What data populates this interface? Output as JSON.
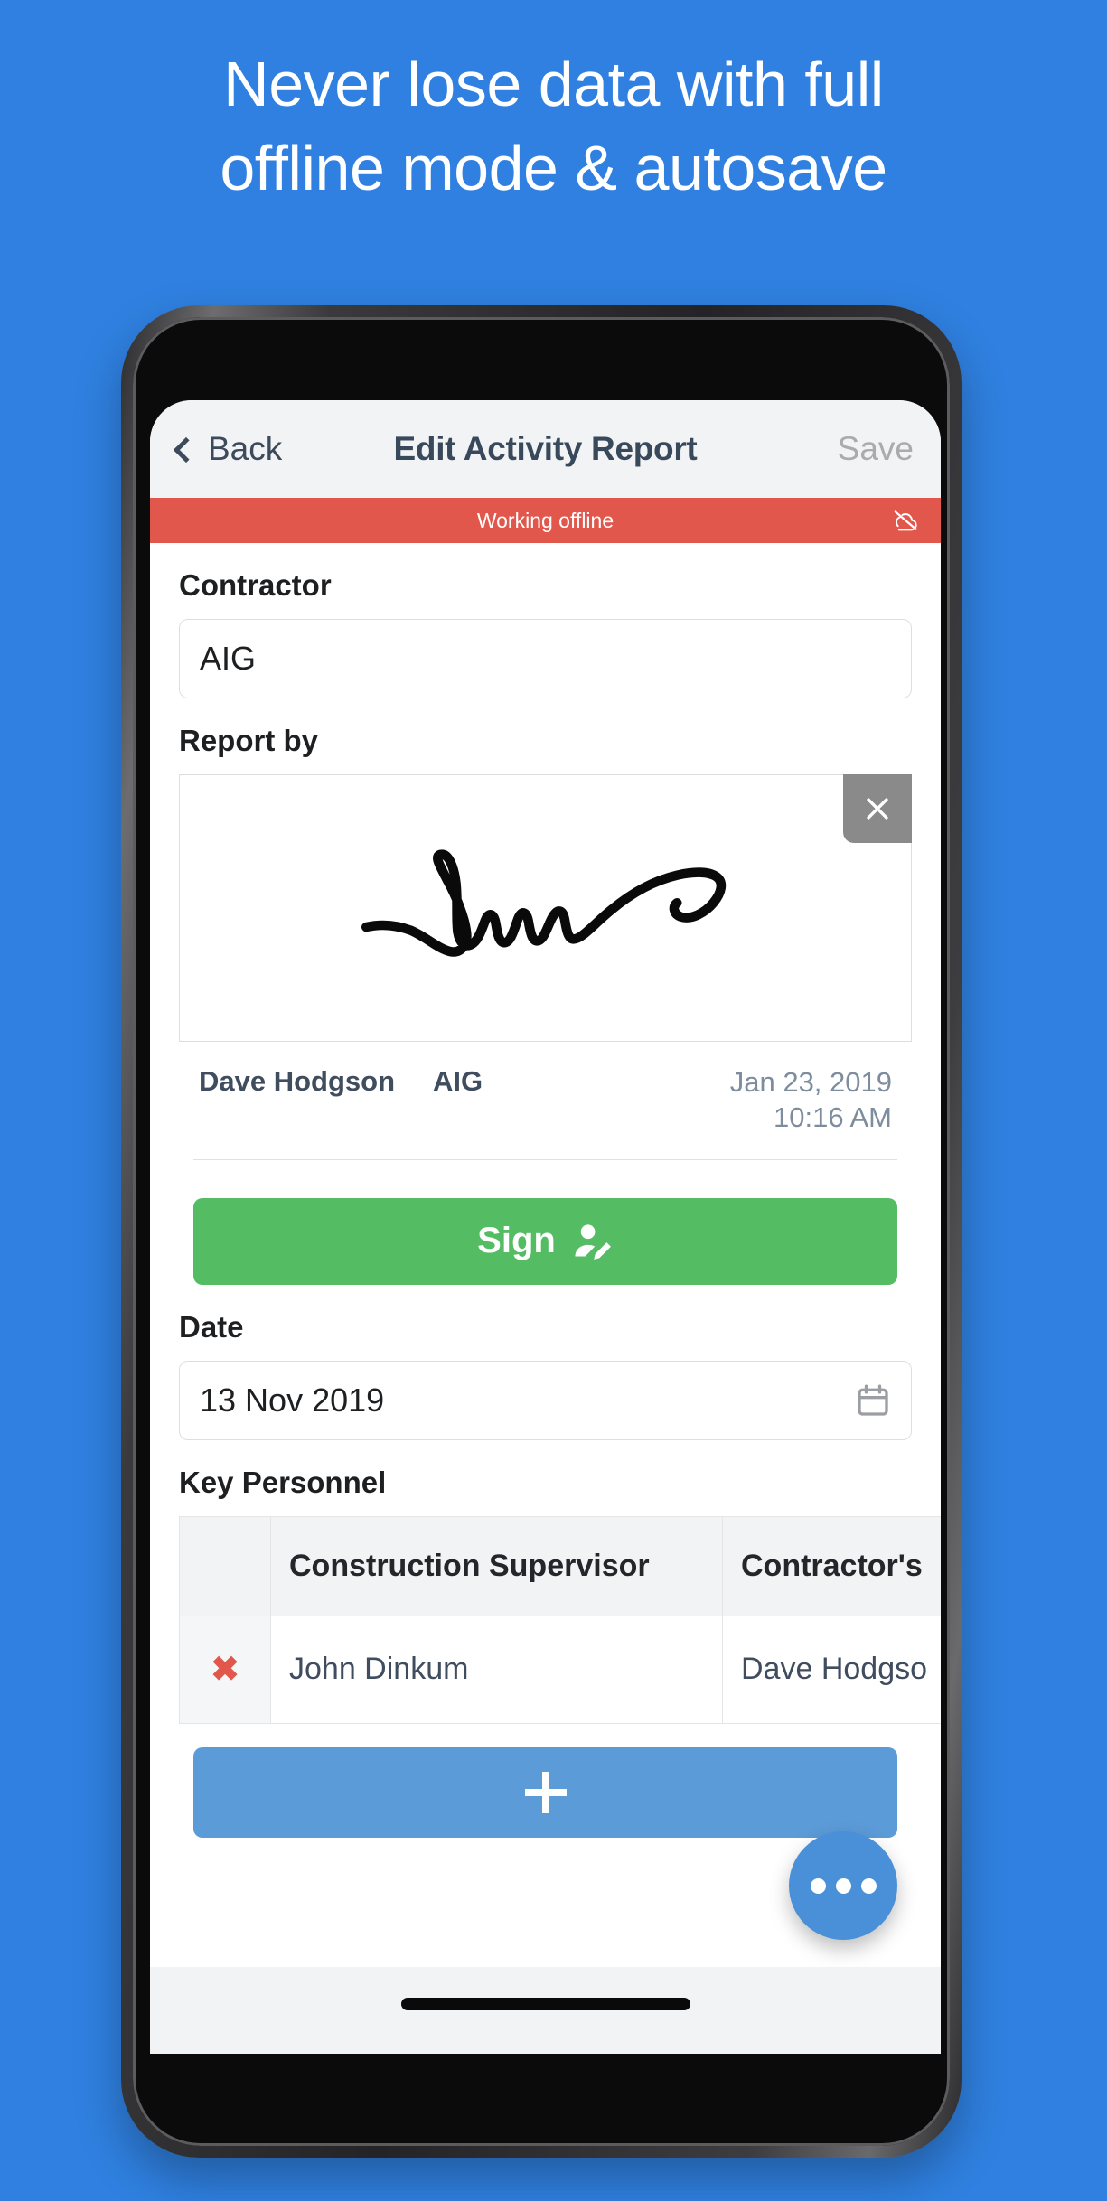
{
  "promo": {
    "headline_line1": "Never lose data with full",
    "headline_line2": "offline mode & autosave",
    "background_color": "#2f80e0",
    "text_color": "#ffffff"
  },
  "app": {
    "navbar": {
      "back_label": "Back",
      "title": "Edit Activity Report",
      "save_label": "Save",
      "save_color": "#a9acaf",
      "background": "#f2f3f4"
    },
    "offline_banner": {
      "text": "Working offline",
      "icon": "cloud-off-icon",
      "color": "#e2574c"
    },
    "contractor": {
      "label": "Contractor",
      "value": "AIG"
    },
    "report_by": {
      "label": "Report by",
      "clear_icon": "close-icon",
      "signature": "handwritten-signature",
      "signer_name": "Dave Hodgson",
      "signer_org": "AIG",
      "signed_date": "Jan 23, 2019",
      "signed_time": "10:16 AM",
      "sign_button_label": "Sign",
      "sign_button_icon": "person-edit-icon",
      "sign_button_color": "#54bd63"
    },
    "date": {
      "label": "Date",
      "value": "13 Nov 2019",
      "icon": "calendar-icon"
    },
    "key_personnel": {
      "label": "Key Personnel",
      "columns": [
        "",
        "Construction Supervisor",
        "Contractor's"
      ],
      "rows": [
        {
          "delete_icon": "delete-x-icon",
          "construction_supervisor": "John Dinkum",
          "contractors": "Dave Hodgso"
        }
      ],
      "add_button_icon": "plus-icon",
      "add_button_color": "#5b9bd8"
    },
    "fab": {
      "icon": "more-options-icon",
      "color": "#4a90d9"
    }
  }
}
